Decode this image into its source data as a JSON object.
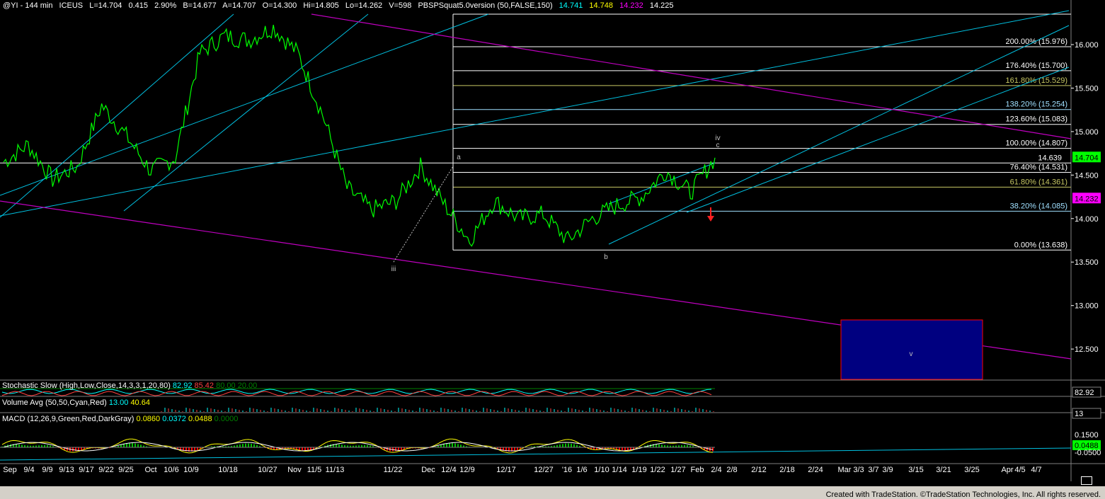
{
  "header": {
    "symbol": "@YI - 144 min",
    "exchange": "ICEUS",
    "last": "L=14.704",
    "change": "0.415",
    "change_pct": "2.90%",
    "bid": "B=14.677",
    "ask": "A=14.707",
    "open": "O=14.300",
    "high": "Hi=14.805",
    "low": "Lo=14.262",
    "volume": "V=598",
    "study": "PBSPSquat5.0version (50,FALSE,150)",
    "study_v1": "14.741",
    "study_v2": "14.748",
    "study_v3": "14.232",
    "study_v4": "14.225"
  },
  "colors": {
    "price": "#00ff00",
    "channel": "#00c0e0",
    "trend": "#c000c0",
    "fib_white": "#ffffff",
    "fib_olive": "#c8c864",
    "fib_cyan": "#a0e0ff",
    "target_box": "#000080",
    "target_border": "#ff0000",
    "last_price_tag": "#00ff00",
    "low_tag": "#ff00ff"
  },
  "price_axis": {
    "ticks": [
      "16.000",
      "15.500",
      "15.000",
      "14.500",
      "14.000",
      "13.500",
      "13.000",
      "12.500"
    ],
    "last_tag": "14.704",
    "low_tag": "14.232"
  },
  "fib_levels": [
    {
      "label": "200.00% (15.976)",
      "price": 15.976,
      "color": "white"
    },
    {
      "label": "176.40% (15.700)",
      "price": 15.7,
      "color": "white"
    },
    {
      "label": "161.80% (15.529)",
      "price": 15.529,
      "color": "olive"
    },
    {
      "label": "138.20% (15.254)",
      "price": 15.254,
      "color": "cyan"
    },
    {
      "label": "123.60% (15.083)",
      "price": 15.083,
      "color": "white"
    },
    {
      "label": "100.00% (14.807)",
      "price": 14.807,
      "color": "white"
    },
    {
      "label": "76.40% (14.531)",
      "price": 14.531,
      "color": "white"
    },
    {
      "label": "61.80% (14.361)",
      "price": 14.361,
      "color": "olive"
    },
    {
      "label": "38.20% (14.085)",
      "price": 14.085,
      "color": "cyan"
    },
    {
      "label": "0.00% (13.638)",
      "price": 13.638,
      "color": "white"
    }
  ],
  "hline_label": "14.639",
  "wave_labels": {
    "a": "a",
    "b": "b",
    "iii": "iii",
    "iv": "iv",
    "c": "c",
    "v": "v"
  },
  "indicators": {
    "stoch_label": "Stochastic Slow (High,Low,Close,14,3,3,1,20,80)",
    "stoch_v1": "82.92",
    "stoch_v2": "85.42",
    "stoch_v3": "80.00",
    "stoch_v4": "20.00",
    "stoch_tag": "82.92",
    "vol_label": "Volume Avg (50,50,Cyan,Red)",
    "vol_v1": "13.00",
    "vol_v2": "40.64",
    "vol_tag": "13",
    "macd_label": "MACD (12,26,9,Green,Red,DarkGray)",
    "macd_v1": "0.0860",
    "macd_v2": "0.0372",
    "macd_v3": "0.0488",
    "macd_v4": "0.0000",
    "macd_tick_top": "0.1500",
    "macd_tick_bottom": "-0.0500",
    "macd_tag": "0.0488"
  },
  "date_axis": [
    "Sep",
    "9/4",
    "9/9",
    "9/13",
    "9/17",
    "9/22",
    "9/25",
    "Oct",
    "10/6",
    "10/9",
    "10/18",
    "10/27",
    "Nov",
    "11/5",
    "11/13",
    "11/22",
    "Dec",
    "12/4",
    "12/9",
    "12/17",
    "12/27",
    "'16",
    "1/6",
    "1/10",
    "1/14",
    "1/19",
    "1/22",
    "1/27",
    "Feb",
    "2/4",
    "2/8",
    "2/12",
    "2/18",
    "2/24",
    "Mar",
    "3/3",
    "3/7",
    "3/9",
    "3/15",
    "3/21",
    "3/25",
    "Apr",
    "4/5",
    "4/7"
  ],
  "footer": "Created with TradeStation. ©TradeStation Technologies, Inc. All rights reserved.",
  "chart_data": {
    "type": "line",
    "title": "@YI - 144 min",
    "ylim": [
      12.2,
      16.35
    ],
    "x": [
      "Sep",
      "9/4",
      "9/9",
      "9/13",
      "9/17",
      "9/22",
      "9/25",
      "Oct",
      "10/6",
      "10/9",
      "10/18",
      "10/27",
      "Nov",
      "11/5",
      "11/13",
      "11/22",
      "Dec",
      "12/4",
      "12/9",
      "12/17",
      "12/27",
      "'16",
      "1/6",
      "1/10",
      "1/14",
      "1/19",
      "1/22",
      "1/27",
      "Feb",
      "2/4"
    ],
    "series": [
      {
        "values": [
          14.65,
          14.85,
          14.45,
          14.6,
          15.3,
          14.95,
          14.55,
          14.7,
          15.9,
          16.1,
          16.05,
          16.2,
          15.9,
          15.2,
          14.35,
          14.1,
          14.2,
          14.6,
          14.15,
          13.75,
          14.2,
          14.0,
          14.05,
          13.75,
          14.0,
          14.15,
          14.25,
          14.55,
          14.3,
          14.7
        ]
      }
    ]
  }
}
